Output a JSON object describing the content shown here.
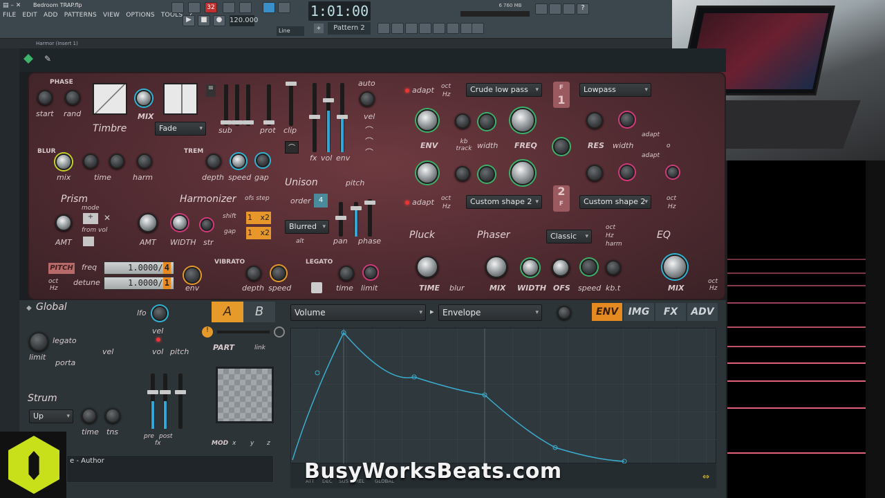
{
  "window": {
    "title": "Bedroom TRAP.flp"
  },
  "menu": [
    "FILE",
    "EDIT",
    "ADD",
    "PATTERNS",
    "VIEW",
    "OPTIONS",
    "TOOLS",
    "?"
  ],
  "transport": {
    "time": "1:01:00",
    "tempo": "120.000",
    "pattern": "Pattern 2",
    "cpu_display": "6",
    "mem_display": "760 MB",
    "snap": "Line",
    "counter_small": "32"
  },
  "plugin_header": "Harmor (Insert 1)",
  "timbre": {
    "phase_label": "PHASE",
    "start": "start",
    "rand": "rand",
    "mix": "MIX",
    "section": "Timbre",
    "fade_select": "Fade"
  },
  "envsliders": {
    "sub": "sub",
    "prot": "prot",
    "clip": "clip",
    "fx": "fx",
    "vol": "vol",
    "env": "env",
    "auto": "auto",
    "vel": "vel"
  },
  "blur": {
    "title": "BLUR",
    "mix": "mix",
    "time": "time",
    "harm": "harm"
  },
  "trem": {
    "title": "TREM",
    "depth": "depth",
    "speed": "speed",
    "gap": "gap"
  },
  "unison": {
    "title": "Unison",
    "pitch": "pitch",
    "order": "order",
    "order_value": "4",
    "mode": "Blurred",
    "alt": "alt",
    "pan": "pan",
    "phase": "phase"
  },
  "prism": {
    "title": "Prism",
    "mode": "mode",
    "from_vol": "from vol",
    "amt": "AMT"
  },
  "harmonizer": {
    "title": "Harmonizer",
    "ofs_step": "ofs step",
    "shift": "shift",
    "gap": "gap",
    "shift_val": "1",
    "gap_val": "1",
    "x2a": "x2",
    "x2b": "x2",
    "amt": "AMT",
    "width": "WIDTH",
    "str": "str"
  },
  "pitch": {
    "label": "PITCH",
    "freq": "freq",
    "detune": "detune",
    "oct": "oct",
    "hz": "Hz",
    "freq_val": "1.0000",
    "freq_mult": "4",
    "detune_val": "1.0000",
    "detune_mult": "1",
    "env": "env"
  },
  "vibrato": {
    "title": "VIBRATO",
    "depth": "depth",
    "speed": "speed"
  },
  "legato": {
    "title": "LEGATO",
    "time": "time",
    "limit": "limit"
  },
  "filter1": {
    "adapt": "adapt",
    "oct": "oct",
    "hz": "Hz",
    "type_select": "Crude low pass",
    "env": "ENV",
    "kb_track": "kb track",
    "width": "width",
    "freq": "FREQ",
    "num": "1",
    "f": "F",
    "type2_select": "Lowpass",
    "res": "RES",
    "width2": "width",
    "adapt2": "adapt",
    "o": "o"
  },
  "filter2": {
    "adapt": "adapt",
    "oct": "oct",
    "hz": "Hz",
    "type_select": "Custom shape 2",
    "type2_select": "Custom shape 2",
    "num": "2",
    "f": "F",
    "adapt2": "adapt",
    "oct2": "oct",
    "hz2": "Hz"
  },
  "pluck": {
    "title": "Pluck",
    "time": "TIME",
    "blur": "blur"
  },
  "phaser": {
    "title": "Phaser",
    "preset": "Classic",
    "oct": "oct",
    "hz": "Hz",
    "harm": "harm",
    "mix": "MIX",
    "width": "WIDTH",
    "ofs": "OFS",
    "speed": "speed",
    "kbt": "kb.t"
  },
  "eq": {
    "title": "EQ",
    "mix": "MIX",
    "oct": "oct",
    "hz": "Hz"
  },
  "global": {
    "title": "Global",
    "lfo": "lfo",
    "legato": "legato",
    "vel": "vel",
    "limit": "limit",
    "porta": "porta",
    "vol": "vol",
    "pitch": "pitch",
    "strum": "Strum",
    "strum_mode": "Up",
    "time": "time",
    "tns": "tns",
    "pre": "pre",
    "post": "post",
    "fx": "fx"
  },
  "part": {
    "a": "A",
    "b": "B",
    "part": "PART",
    "link": "link",
    "mod": "MOD",
    "x": "x",
    "y": "y",
    "z": "z"
  },
  "env_editor": {
    "target": "Volume",
    "mode": "Envelope",
    "tabs": [
      "ENV",
      "IMG",
      "FX",
      "ADV"
    ],
    "active_tab": "ENV",
    "footer": [
      "ATT",
      "DEC",
      "SUS",
      "REL",
      "GLOBAL"
    ]
  },
  "author": {
    "text": "e - Author"
  },
  "watermark": "BusyWorksBeats.com",
  "colors": {
    "accent": "#e59a2a",
    "panel": "#5a2f35",
    "knob_green": "#3bb36a",
    "knob_cyan": "#2fb6d6",
    "knob_pink": "#d23a7a",
    "envelope_line": "#3aaed0"
  }
}
